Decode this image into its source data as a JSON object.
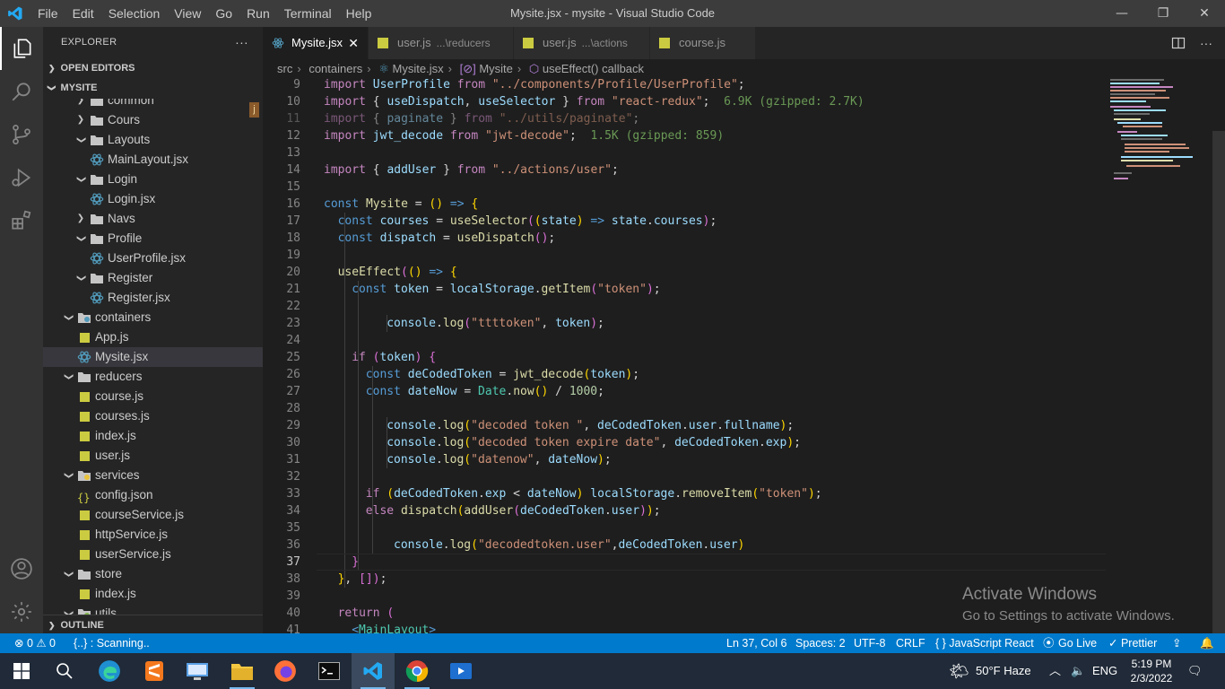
{
  "window": {
    "menu": [
      "File",
      "Edit",
      "Selection",
      "View",
      "Go",
      "Run",
      "Terminal",
      "Help"
    ],
    "title": "Mysite.jsx - mysite - Visual Studio Code",
    "controls": [
      "—",
      "❐",
      "✕"
    ]
  },
  "sidebar": {
    "title": "EXPLORER",
    "more": "···",
    "open_editors": "OPEN EDITORS",
    "project": "MYSITE",
    "outline": "OUTLINE",
    "badge": "j",
    "tree": [
      {
        "label": "common",
        "kind": "folder",
        "open": false,
        "depth": 2
      },
      {
        "label": "Cours",
        "kind": "folder",
        "open": false,
        "depth": 2
      },
      {
        "label": "Layouts",
        "kind": "folder",
        "open": true,
        "depth": 2
      },
      {
        "label": "MainLayout.jsx",
        "kind": "react",
        "depth": 3
      },
      {
        "label": "Login",
        "kind": "folder",
        "open": true,
        "depth": 2
      },
      {
        "label": "Login.jsx",
        "kind": "react",
        "depth": 3
      },
      {
        "label": "Navs",
        "kind": "folder",
        "open": false,
        "depth": 2
      },
      {
        "label": "Profile",
        "kind": "folder",
        "open": true,
        "depth": 2
      },
      {
        "label": "UserProfile.jsx",
        "kind": "react",
        "depth": 3
      },
      {
        "label": "Register",
        "kind": "folder",
        "open": true,
        "depth": 2
      },
      {
        "label": "Register.jsx",
        "kind": "react",
        "depth": 3
      },
      {
        "label": "containers",
        "kind": "special-folder",
        "open": true,
        "depth": 1
      },
      {
        "label": "App.js",
        "kind": "js",
        "depth": 2
      },
      {
        "label": "Mysite.jsx",
        "kind": "react",
        "depth": 2,
        "selected": true
      },
      {
        "label": "reducers",
        "kind": "folder",
        "open": true,
        "depth": 1
      },
      {
        "label": "course.js",
        "kind": "js",
        "depth": 2
      },
      {
        "label": "courses.js",
        "kind": "js",
        "depth": 2
      },
      {
        "label": "index.js",
        "kind": "js",
        "depth": 2
      },
      {
        "label": "user.js",
        "kind": "js",
        "depth": 2
      },
      {
        "label": "services",
        "kind": "special-folder",
        "open": true,
        "depth": 1
      },
      {
        "label": "config.json",
        "kind": "json",
        "depth": 2
      },
      {
        "label": "courseService.js",
        "kind": "js",
        "depth": 2
      },
      {
        "label": "httpService.js",
        "kind": "js",
        "depth": 2
      },
      {
        "label": "userService.js",
        "kind": "js",
        "depth": 2
      },
      {
        "label": "store",
        "kind": "folder",
        "open": true,
        "depth": 1
      },
      {
        "label": "index.js",
        "kind": "js",
        "depth": 2
      },
      {
        "label": "utils",
        "kind": "special-folder",
        "open": true,
        "depth": 1
      }
    ]
  },
  "tabs": [
    {
      "name": "Mysite.jsx",
      "desc": "",
      "kind": "react",
      "active": true
    },
    {
      "name": "user.js",
      "desc": "...\\reducers",
      "kind": "js",
      "active": false
    },
    {
      "name": "user.js",
      "desc": "...\\actions",
      "kind": "js",
      "active": false
    },
    {
      "name": "course.js",
      "desc": "",
      "kind": "js",
      "active": false
    }
  ],
  "breadcrumb": [
    "src",
    "containers",
    "Mysite.jsx",
    "Mysite",
    "useEffect() callback"
  ],
  "editor": {
    "current_line": 37,
    "lines": [
      {
        "n": "9",
        "indent": 0,
        "tokens": [
          [
            "k",
            "import "
          ],
          [
            "v",
            "UserProfile "
          ],
          [
            "k",
            "from "
          ],
          [
            "s",
            "\"../components/Profile/UserProfile\""
          ],
          [
            "t",
            ";"
          ]
        ]
      },
      {
        "n": "10",
        "indent": 0,
        "tokens": [
          [
            "k",
            "import "
          ],
          [
            "t",
            "{ "
          ],
          [
            "v",
            "useDispatch"
          ],
          [
            "t",
            ", "
          ],
          [
            "v",
            "useSelector "
          ],
          [
            "t",
            "} "
          ],
          [
            "k",
            "from "
          ],
          [
            "s",
            "\"react-redux\""
          ],
          [
            "t",
            ";  "
          ],
          [
            "g",
            "6.9K (gzipped: 2.7K)"
          ]
        ]
      },
      {
        "n": "11",
        "indent": 0,
        "dim": true,
        "tokens": [
          [
            "k",
            "import "
          ],
          [
            "t",
            "{ "
          ],
          [
            "v",
            "paginate "
          ],
          [
            "t",
            "} "
          ],
          [
            "k",
            "from "
          ],
          [
            "s",
            "\"../utils/paginate\""
          ],
          [
            "t",
            ";"
          ]
        ]
      },
      {
        "n": "12",
        "indent": 0,
        "tokens": [
          [
            "k",
            "import "
          ],
          [
            "v",
            "jwt_decode "
          ],
          [
            "k",
            "from "
          ],
          [
            "s",
            "\"jwt-decode\""
          ],
          [
            "t",
            ";  "
          ],
          [
            "g",
            "1.5K (gzipped: 859)"
          ]
        ]
      },
      {
        "n": "13",
        "indent": 0,
        "tokens": []
      },
      {
        "n": "14",
        "indent": 0,
        "tokens": [
          [
            "k",
            "import "
          ],
          [
            "t",
            "{ "
          ],
          [
            "v",
            "addUser "
          ],
          [
            "t",
            "} "
          ],
          [
            "k",
            "from "
          ],
          [
            "s",
            "\"../actions/user\""
          ],
          [
            "t",
            ";"
          ]
        ]
      },
      {
        "n": "15",
        "indent": 0,
        "tokens": []
      },
      {
        "n": "16",
        "indent": 0,
        "tokens": [
          [
            "b",
            "const "
          ],
          [
            "f",
            "Mysite "
          ],
          [
            "t",
            "= "
          ],
          [
            "p",
            "("
          ],
          [
            "p",
            ")"
          ],
          [
            "t",
            " "
          ],
          [
            "b",
            "=>"
          ],
          [
            "t",
            " "
          ],
          [
            "p",
            "{"
          ]
        ]
      },
      {
        "n": "17",
        "indent": 2,
        "tokens": [
          [
            "b",
            "const "
          ],
          [
            "v",
            "courses "
          ],
          [
            "t",
            "= "
          ],
          [
            "f",
            "useSelector"
          ],
          [
            "d",
            "("
          ],
          [
            "p",
            "("
          ],
          [
            "v",
            "state"
          ],
          [
            "p",
            ")"
          ],
          [
            "t",
            " "
          ],
          [
            "b",
            "=>"
          ],
          [
            "t",
            " "
          ],
          [
            "v",
            "state"
          ],
          [
            "t",
            "."
          ],
          [
            "v",
            "courses"
          ],
          [
            "d",
            ")"
          ],
          [
            "t",
            ";"
          ]
        ]
      },
      {
        "n": "18",
        "indent": 2,
        "tokens": [
          [
            "b",
            "const "
          ],
          [
            "v",
            "dispatch "
          ],
          [
            "t",
            "= "
          ],
          [
            "f",
            "useDispatch"
          ],
          [
            "d",
            "()"
          ],
          [
            "t",
            ";"
          ]
        ]
      },
      {
        "n": "19",
        "indent": 0,
        "tokens": []
      },
      {
        "n": "20",
        "indent": 2,
        "tokens": [
          [
            "f",
            "useEffect"
          ],
          [
            "d",
            "("
          ],
          [
            "p",
            "("
          ],
          [
            "p",
            ")"
          ],
          [
            "t",
            " "
          ],
          [
            "b",
            "=>"
          ],
          [
            "t",
            " "
          ],
          [
            "p",
            "{"
          ]
        ]
      },
      {
        "n": "21",
        "indent": 4,
        "tokens": [
          [
            "b",
            "const "
          ],
          [
            "v",
            "token "
          ],
          [
            "t",
            "= "
          ],
          [
            "v",
            "localStorage"
          ],
          [
            "t",
            "."
          ],
          [
            "f",
            "getItem"
          ],
          [
            "d",
            "("
          ],
          [
            "s",
            "\"token\""
          ],
          [
            "d",
            ")"
          ],
          [
            "t",
            ";"
          ]
        ]
      },
      {
        "n": "22",
        "indent": 0,
        "tokens": []
      },
      {
        "n": "23",
        "indent": 9,
        "tokens": [
          [
            "v",
            "console"
          ],
          [
            "t",
            "."
          ],
          [
            "f",
            "log"
          ],
          [
            "d",
            "("
          ],
          [
            "s",
            "\"ttttoken\""
          ],
          [
            "t",
            ", "
          ],
          [
            "v",
            "token"
          ],
          [
            "d",
            ")"
          ],
          [
            "t",
            ";"
          ]
        ]
      },
      {
        "n": "24",
        "indent": 0,
        "tokens": []
      },
      {
        "n": "25",
        "indent": 4,
        "tokens": [
          [
            "k",
            "if "
          ],
          [
            "d",
            "("
          ],
          [
            "v",
            "token"
          ],
          [
            "d",
            ")"
          ],
          [
            "t",
            " "
          ],
          [
            "d",
            "{"
          ]
        ]
      },
      {
        "n": "26",
        "indent": 6,
        "tokens": [
          [
            "b",
            "const "
          ],
          [
            "v",
            "deCodedToken "
          ],
          [
            "t",
            "= "
          ],
          [
            "f",
            "jwt_decode"
          ],
          [
            "p",
            "("
          ],
          [
            "v",
            "token"
          ],
          [
            "p",
            ")"
          ],
          [
            "t",
            ";"
          ]
        ]
      },
      {
        "n": "27",
        "indent": 6,
        "tokens": [
          [
            "b",
            "const "
          ],
          [
            "v",
            "dateNow "
          ],
          [
            "t",
            "= "
          ],
          [
            "c",
            "Date"
          ],
          [
            "t",
            "."
          ],
          [
            "f",
            "now"
          ],
          [
            "p",
            "()"
          ],
          [
            "t",
            " / "
          ],
          [
            "n",
            "1000"
          ],
          [
            "t",
            ";"
          ]
        ]
      },
      {
        "n": "28",
        "indent": 0,
        "tokens": []
      },
      {
        "n": "29",
        "indent": 9,
        "tokens": [
          [
            "v",
            "console"
          ],
          [
            "t",
            "."
          ],
          [
            "f",
            "log"
          ],
          [
            "p",
            "("
          ],
          [
            "s",
            "\"decoded token \""
          ],
          [
            "t",
            ", "
          ],
          [
            "v",
            "deCodedToken"
          ],
          [
            "t",
            "."
          ],
          [
            "v",
            "user"
          ],
          [
            "t",
            "."
          ],
          [
            "v",
            "fullname"
          ],
          [
            "p",
            ")"
          ],
          [
            "t",
            ";"
          ]
        ]
      },
      {
        "n": "30",
        "indent": 9,
        "tokens": [
          [
            "v",
            "console"
          ],
          [
            "t",
            "."
          ],
          [
            "f",
            "log"
          ],
          [
            "p",
            "("
          ],
          [
            "s",
            "\"decoded token expire date\""
          ],
          [
            "t",
            ", "
          ],
          [
            "v",
            "deCodedToken"
          ],
          [
            "t",
            "."
          ],
          [
            "v",
            "exp"
          ],
          [
            "p",
            ")"
          ],
          [
            "t",
            ";"
          ]
        ]
      },
      {
        "n": "31",
        "indent": 9,
        "tokens": [
          [
            "v",
            "console"
          ],
          [
            "t",
            "."
          ],
          [
            "f",
            "log"
          ],
          [
            "p",
            "("
          ],
          [
            "s",
            "\"datenow\""
          ],
          [
            "t",
            ", "
          ],
          [
            "v",
            "dateNow"
          ],
          [
            "p",
            ")"
          ],
          [
            "t",
            ";"
          ]
        ]
      },
      {
        "n": "32",
        "indent": 0,
        "tokens": []
      },
      {
        "n": "33",
        "indent": 6,
        "tokens": [
          [
            "k",
            "if "
          ],
          [
            "p",
            "("
          ],
          [
            "v",
            "deCodedToken"
          ],
          [
            "t",
            "."
          ],
          [
            "v",
            "exp "
          ],
          [
            "t",
            "< "
          ],
          [
            "v",
            "dateNow"
          ],
          [
            "p",
            ")"
          ],
          [
            "t",
            " "
          ],
          [
            "v",
            "localStorage"
          ],
          [
            "t",
            "."
          ],
          [
            "f",
            "removeItem"
          ],
          [
            "p",
            "("
          ],
          [
            "s",
            "\"token\""
          ],
          [
            "p",
            ")"
          ],
          [
            "t",
            ";"
          ]
        ]
      },
      {
        "n": "34",
        "indent": 6,
        "tokens": [
          [
            "k",
            "else "
          ],
          [
            "f",
            "dispatch"
          ],
          [
            "p",
            "("
          ],
          [
            "f",
            "addUser"
          ],
          [
            "d",
            "("
          ],
          [
            "v",
            "deCodedToken"
          ],
          [
            "t",
            "."
          ],
          [
            "v",
            "user"
          ],
          [
            "d",
            ")"
          ],
          [
            "p",
            ")"
          ],
          [
            "t",
            ";"
          ]
        ]
      },
      {
        "n": "35",
        "indent": 0,
        "tokens": []
      },
      {
        "n": "36",
        "indent": 10,
        "tokens": [
          [
            "v",
            "console"
          ],
          [
            "t",
            "."
          ],
          [
            "f",
            "log"
          ],
          [
            "p",
            "("
          ],
          [
            "s",
            "\"decodedtoken.user\""
          ],
          [
            "t",
            ","
          ],
          [
            "v",
            "deCodedToken"
          ],
          [
            "t",
            "."
          ],
          [
            "v",
            "user"
          ],
          [
            "p",
            ")"
          ]
        ]
      },
      {
        "n": "37",
        "indent": 2,
        "tokens": [
          [
            "t",
            "  "
          ],
          [
            "d",
            "}"
          ]
        ]
      },
      {
        "n": "38",
        "indent": 2,
        "tokens": [
          [
            "p",
            "}"
          ],
          [
            "t",
            ", "
          ],
          [
            "d",
            "[]"
          ],
          [
            "d",
            ")"
          ],
          [
            "t",
            ";"
          ]
        ]
      },
      {
        "n": "39",
        "indent": 0,
        "tokens": []
      },
      {
        "n": "40",
        "indent": 2,
        "tokens": [
          [
            "k",
            "return "
          ],
          [
            "d",
            "("
          ]
        ]
      },
      {
        "n": "41",
        "indent": 4,
        "tokens": [
          [
            "b",
            "<"
          ],
          [
            "c",
            "MainLayout"
          ],
          [
            "b",
            ">"
          ]
        ]
      }
    ]
  },
  "watermark": {
    "line1": "Activate Windows",
    "line2": "Go to Settings to activate Windows."
  },
  "statusbar": {
    "problems": "⊗ 0 ⚠ 0",
    "scanning": "{..} : Scanning..",
    "position": "Ln 37, Col 6",
    "spaces": "Spaces: 2",
    "encoding": "UTF-8",
    "eol": "CRLF",
    "language": "{ } JavaScript React",
    "golive": "Go Live",
    "prettier": "✓ Prettier"
  },
  "taskbar": {
    "weather": "50°F  Haze",
    "lang": "ENG",
    "time": "5:19 PM",
    "date": "2/3/2022"
  },
  "colors": {
    "accent": "#007acc",
    "react_icon": "#519aba",
    "js_icon": "#cbcb41",
    "folder": "#c5c5c5"
  }
}
